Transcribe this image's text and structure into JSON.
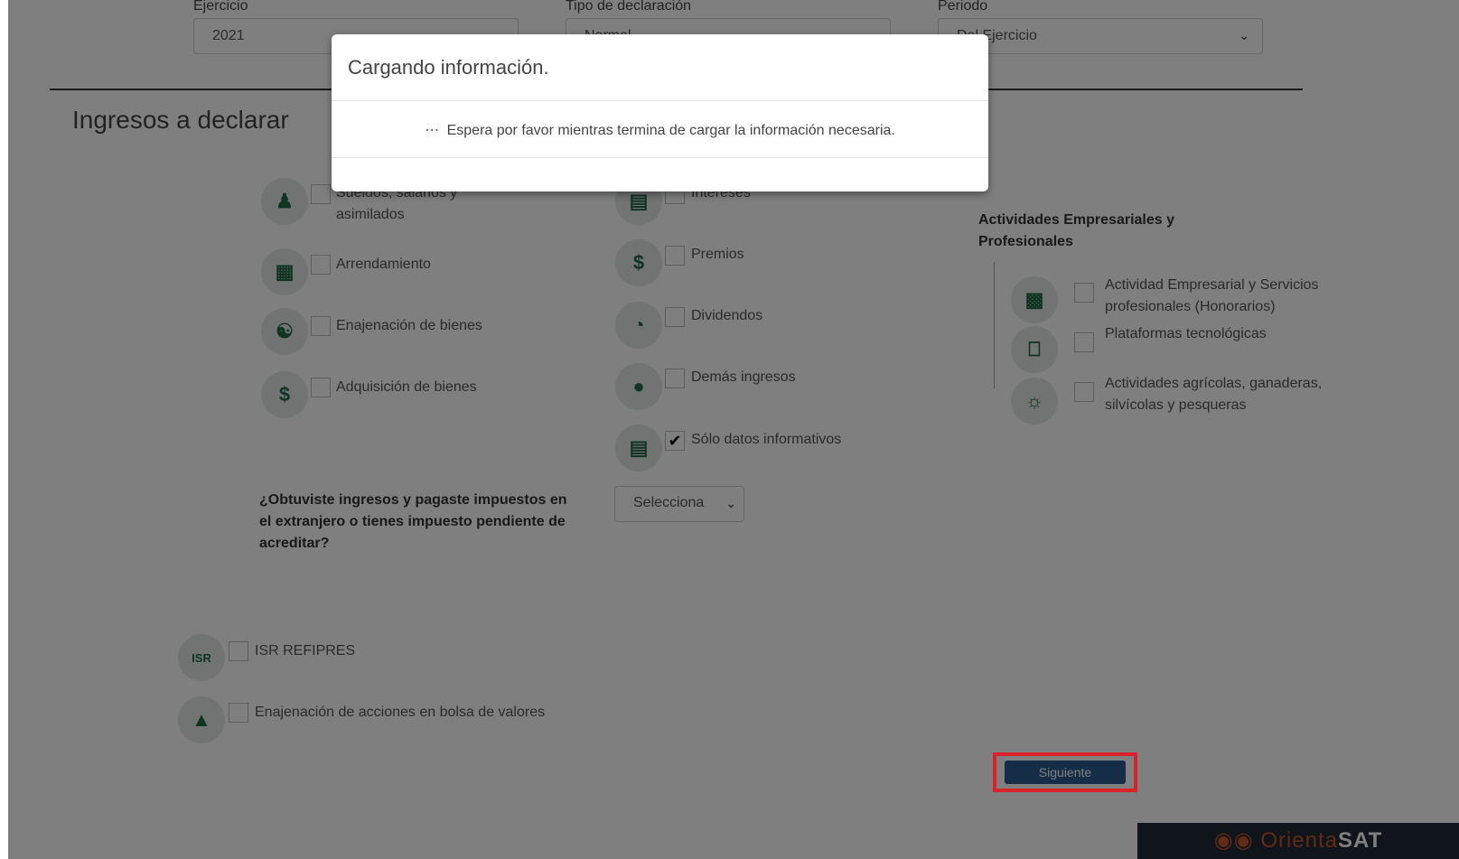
{
  "form": {
    "ejercicio_label": "Ejercicio",
    "ejercicio_value": "2021",
    "tipo_label": "Tipo de declaración",
    "tipo_value": "Normal",
    "periodo_label": "Periodo",
    "periodo_value": "Del Ejercicio"
  },
  "section_title": "Ingresos a declarar",
  "col1": [
    {
      "label": "Sueldos, salarios y asimilados",
      "checked": false,
      "icon": "people-icon"
    },
    {
      "label": "Arrendamiento",
      "checked": false,
      "icon": "building-icon"
    },
    {
      "label": "Enajenación de bienes",
      "checked": false,
      "icon": "handshake-icon"
    },
    {
      "label": "Adquisición de bienes",
      "checked": false,
      "icon": "money-bag-icon"
    }
  ],
  "col2": [
    {
      "label": "Intereses",
      "checked": false,
      "icon": "bank-icon"
    },
    {
      "label": "Premios",
      "checked": false,
      "icon": "medal-icon"
    },
    {
      "label": "Dividendos",
      "checked": false,
      "icon": "pie-chart-icon"
    },
    {
      "label": "Demás ingresos",
      "checked": false,
      "icon": "coins-icon"
    },
    {
      "label": "Sólo datos informativos",
      "checked": true,
      "icon": "document-icon"
    }
  ],
  "col3": {
    "title": "Actividades Empresariales y Profesionales",
    "items": [
      {
        "label": "Actividad Empresarial y Servicios profesionales (Honorarios)",
        "checked": false,
        "icon": "store-icon"
      },
      {
        "label": "Plataformas tecnológicas",
        "checked": false,
        "icon": "monitor-icon"
      },
      {
        "label": "Actividades agrícolas, ganaderas, silvícolas y pesqueras",
        "checked": false,
        "icon": "bull-icon"
      }
    ]
  },
  "foreign": {
    "question": "¿Obtuviste ingresos y pagaste impuestos en el extranjero o tienes impuesto pendiente de acreditar?",
    "select_value": "Selecciona"
  },
  "extras": [
    {
      "label": "ISR REFIPRES",
      "checked": false,
      "icon_text": "ISR"
    },
    {
      "label": "Enajenación de acciones en bolsa de valores",
      "checked": false,
      "icon": "growth-chart-icon"
    }
  ],
  "next_button": "Siguiente",
  "brand": {
    "orienta": "Orienta",
    "sat": "SAT"
  },
  "modal": {
    "title": "Cargando información.",
    "message": "Espera por favor mientras termina de cargar la información necesaria."
  }
}
